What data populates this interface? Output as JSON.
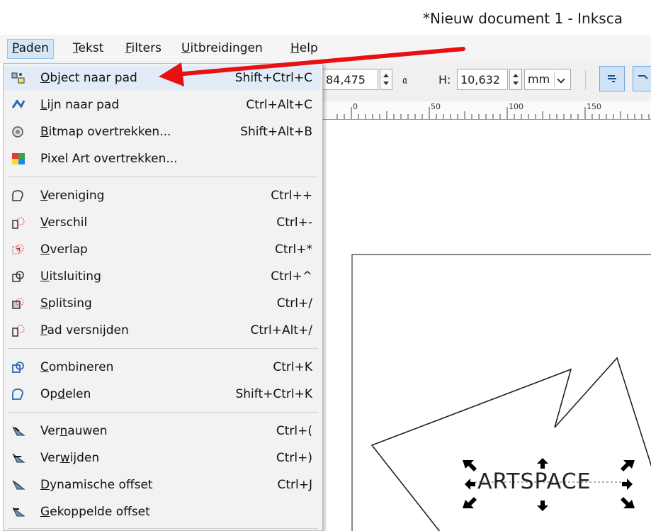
{
  "window": {
    "title": "*Nieuw document 1 - Inksca"
  },
  "menubar": {
    "items": [
      {
        "label": "Paden",
        "mnemonic": "P",
        "rest": "aden"
      },
      {
        "label": "Tekst",
        "mnemonic": "T",
        "rest": "ekst"
      },
      {
        "label": "Filters",
        "mnemonic": "F",
        "rest": "ilters"
      },
      {
        "label": "Uitbreidingen",
        "mnemonic": "U",
        "rest": "itbreidingen"
      },
      {
        "label": "Help",
        "mnemonic": "H",
        "rest": "elp"
      }
    ]
  },
  "toolbar": {
    "w_value": "84,475",
    "h_label": "H:",
    "h_value": "10,632",
    "unit": "mm"
  },
  "ruler": {
    "labels": [
      "0",
      "50",
      "100",
      "150"
    ]
  },
  "menu": {
    "groups": [
      [
        {
          "pre": "",
          "u": "O",
          "post": "bject naar pad",
          "shortcut": "Shift+Ctrl+C",
          "icon": "object-to-path-icon"
        },
        {
          "pre": "",
          "u": "L",
          "post": "ijn naar pad",
          "shortcut": "Ctrl+Alt+C",
          "icon": "stroke-to-path-icon"
        },
        {
          "pre": "",
          "u": "B",
          "post": "itmap overtrekken...",
          "shortcut": "Shift+Alt+B",
          "icon": "trace-bitmap-icon"
        },
        {
          "pre": "Pixel Art overtrekken...",
          "u": "",
          "post": "",
          "shortcut": "",
          "icon": "trace-pixel-art-icon"
        }
      ],
      [
        {
          "pre": "",
          "u": "V",
          "post": "ereniging",
          "shortcut": "Ctrl++",
          "icon": "union-icon"
        },
        {
          "pre": "",
          "u": "V",
          "post": "erschil",
          "shortcut": "Ctrl+-",
          "icon": "difference-icon"
        },
        {
          "pre": "",
          "u": "O",
          "post": "verlap",
          "shortcut": "Ctrl+*",
          "icon": "intersection-icon"
        },
        {
          "pre": "",
          "u": "U",
          "post": "itsluiting",
          "shortcut": "Ctrl+^",
          "icon": "exclusion-icon"
        },
        {
          "pre": "",
          "u": "S",
          "post": "plitsing",
          "shortcut": "Ctrl+/",
          "icon": "division-icon"
        },
        {
          "pre": "",
          "u": "P",
          "post": "ad versnijden",
          "shortcut": "Ctrl+Alt+/",
          "icon": "cut-path-icon"
        }
      ],
      [
        {
          "pre": "",
          "u": "C",
          "post": "ombineren",
          "shortcut": "Ctrl+K",
          "icon": "combine-icon"
        },
        {
          "pre": "Op",
          "u": "d",
          "post": "elen",
          "shortcut": "Shift+Ctrl+K",
          "icon": "break-apart-icon"
        }
      ],
      [
        {
          "pre": "Ver",
          "u": "n",
          "post": "auwen",
          "shortcut": "Ctrl+(",
          "icon": "inset-icon"
        },
        {
          "pre": "Ver",
          "u": "w",
          "post": "ijden",
          "shortcut": "Ctrl+)",
          "icon": "outset-icon"
        },
        {
          "pre": "",
          "u": "D",
          "post": "ynamische offset",
          "shortcut": "Ctrl+J",
          "icon": "dynamic-offset-icon"
        },
        {
          "pre": "",
          "u": "G",
          "post": "ekoppelde offset",
          "shortcut": "",
          "icon": "linked-offset-icon"
        }
      ]
    ]
  },
  "canvas": {
    "text_object": "ARTSPACE"
  },
  "colors": {
    "annotation_arrow": "#e81010",
    "menu_highlight": "#e1ecf8",
    "accent": "#6fa7dc"
  }
}
